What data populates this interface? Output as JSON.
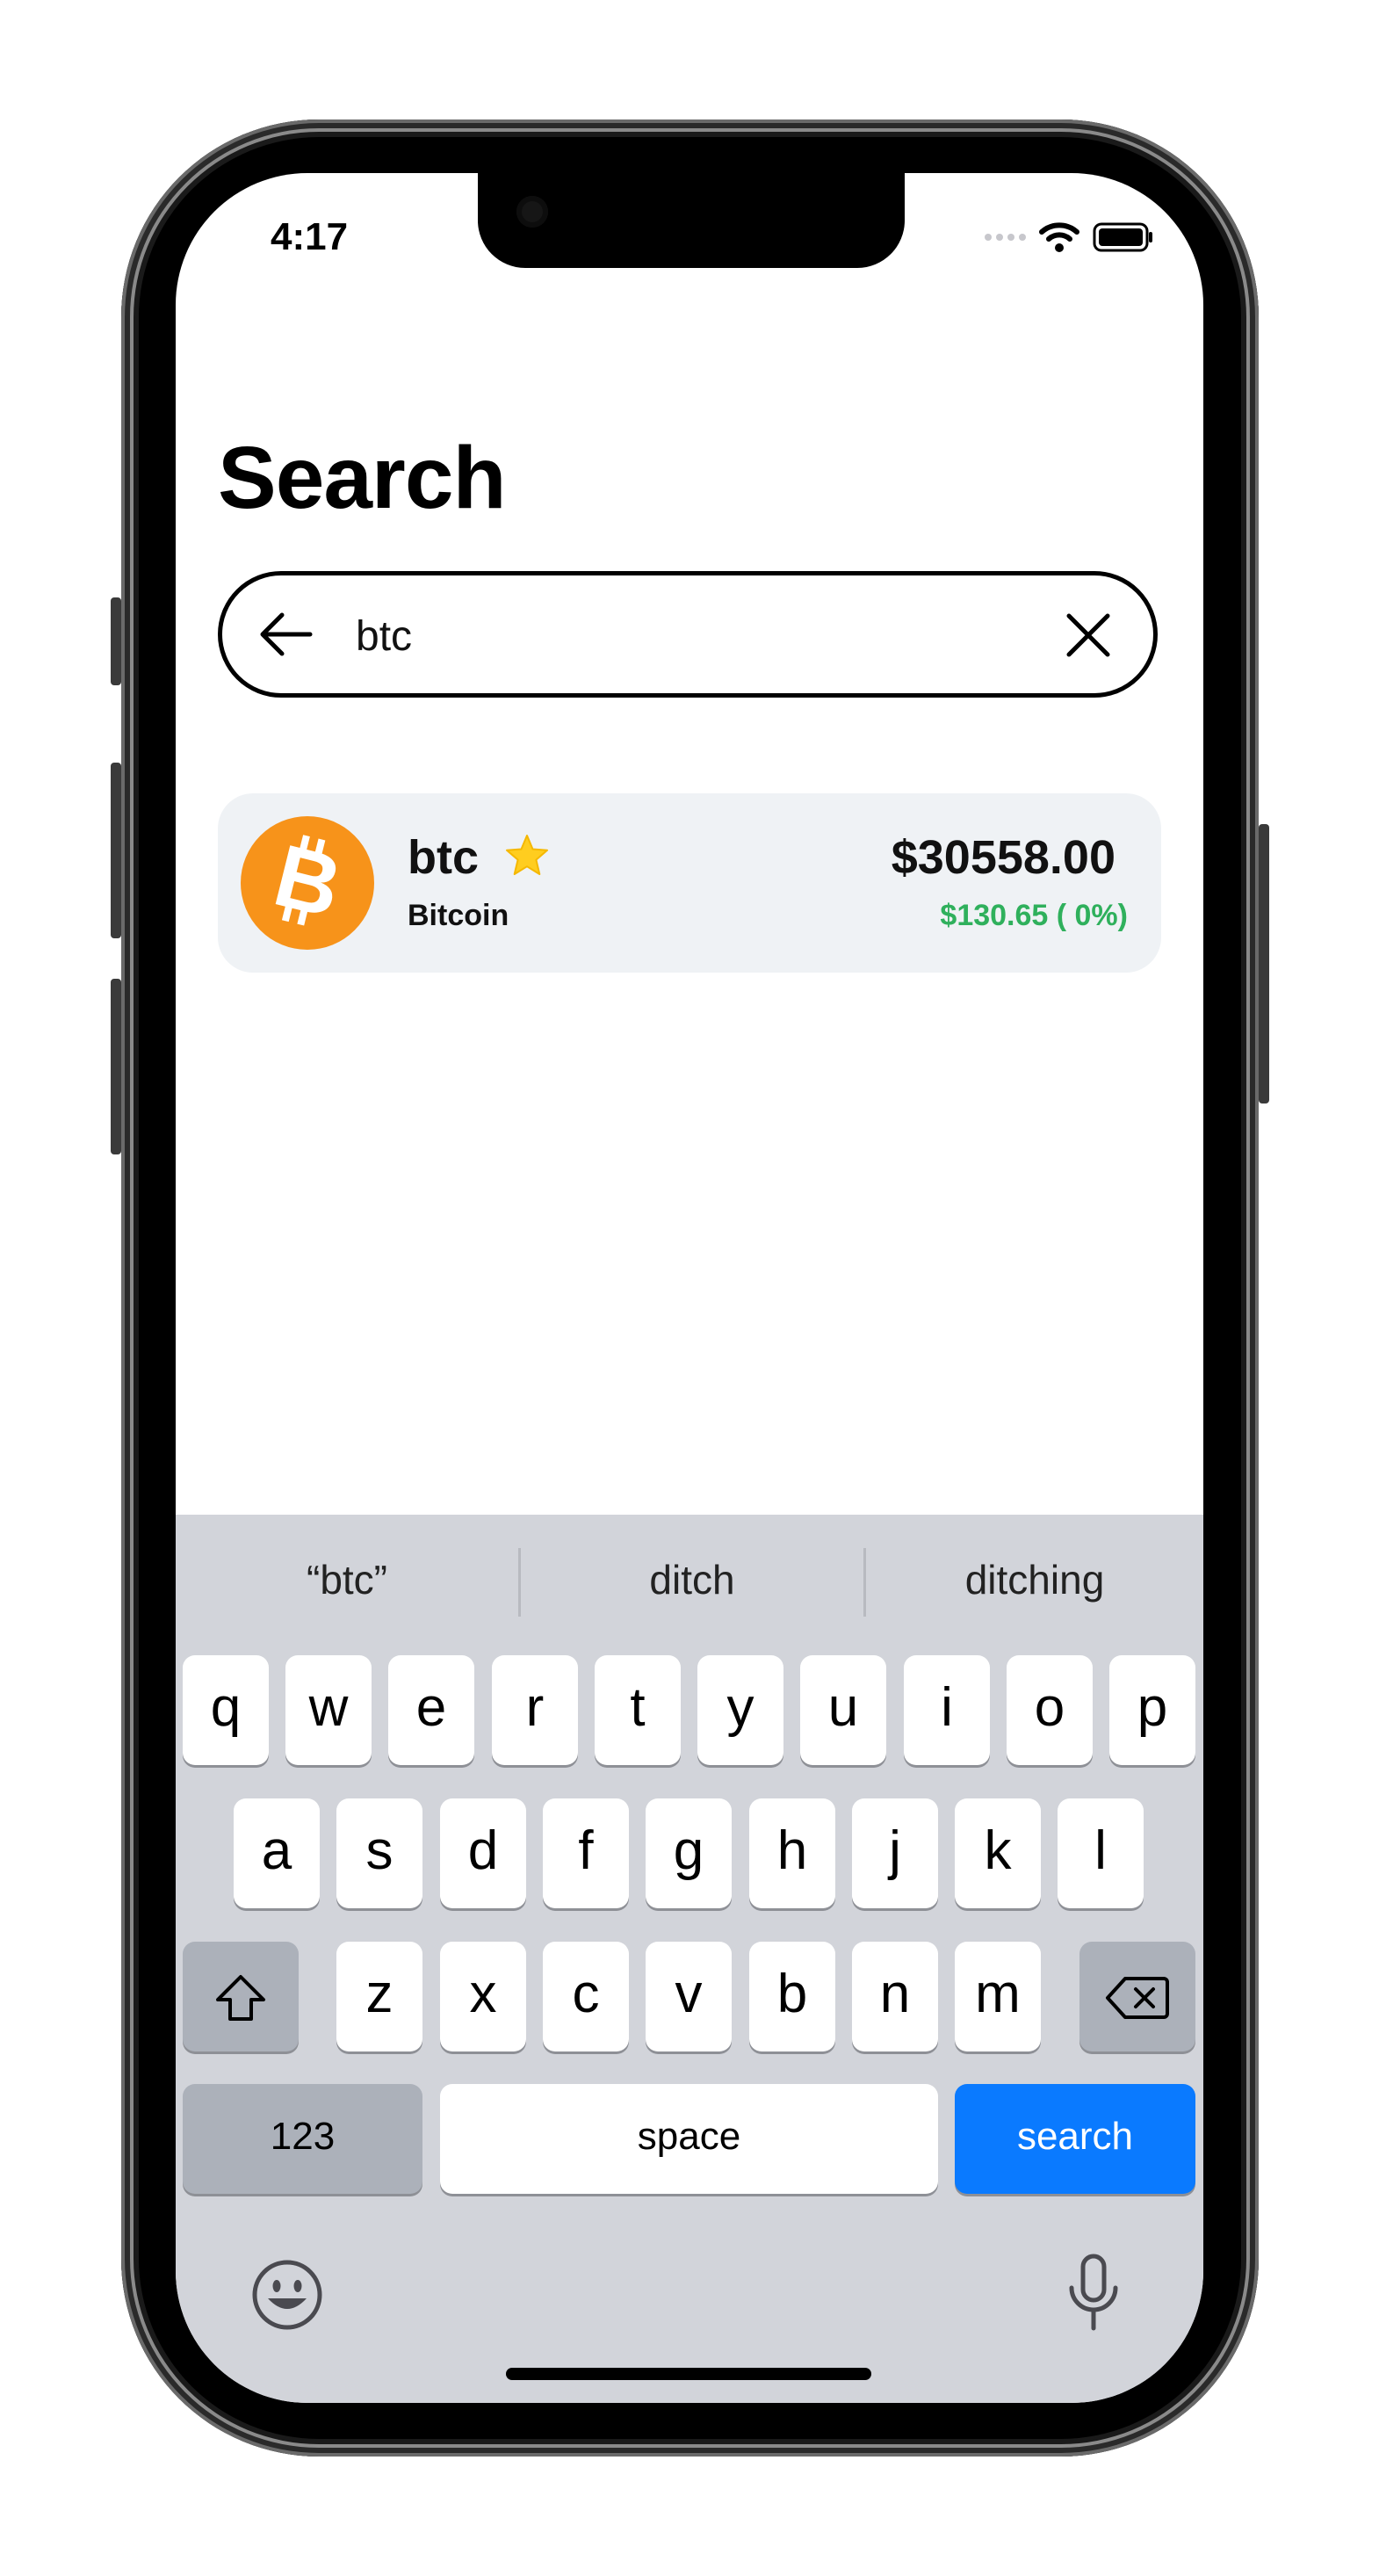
{
  "status_bar": {
    "time": "4:17"
  },
  "page": {
    "title": "Search"
  },
  "search": {
    "value": "btc",
    "placeholder": ""
  },
  "results": [
    {
      "symbol": "btc",
      "name": "Bitcoin",
      "price": "$30558.00",
      "change": "$130.65 ( 0%)",
      "favorite": true,
      "logo_color": "#f7931a",
      "change_color": "#2fb05c"
    }
  ],
  "keyboard": {
    "suggestions": [
      "“btc”",
      "ditch",
      "ditching"
    ],
    "row1": [
      "q",
      "w",
      "e",
      "r",
      "t",
      "y",
      "u",
      "i",
      "o",
      "p"
    ],
    "row2": [
      "a",
      "s",
      "d",
      "f",
      "g",
      "h",
      "j",
      "k",
      "l"
    ],
    "row3": [
      "z",
      "x",
      "c",
      "v",
      "b",
      "n",
      "m"
    ],
    "numbers_label": "123",
    "space_label": "space",
    "action_label": "search",
    "action_color": "#0a7aff"
  }
}
